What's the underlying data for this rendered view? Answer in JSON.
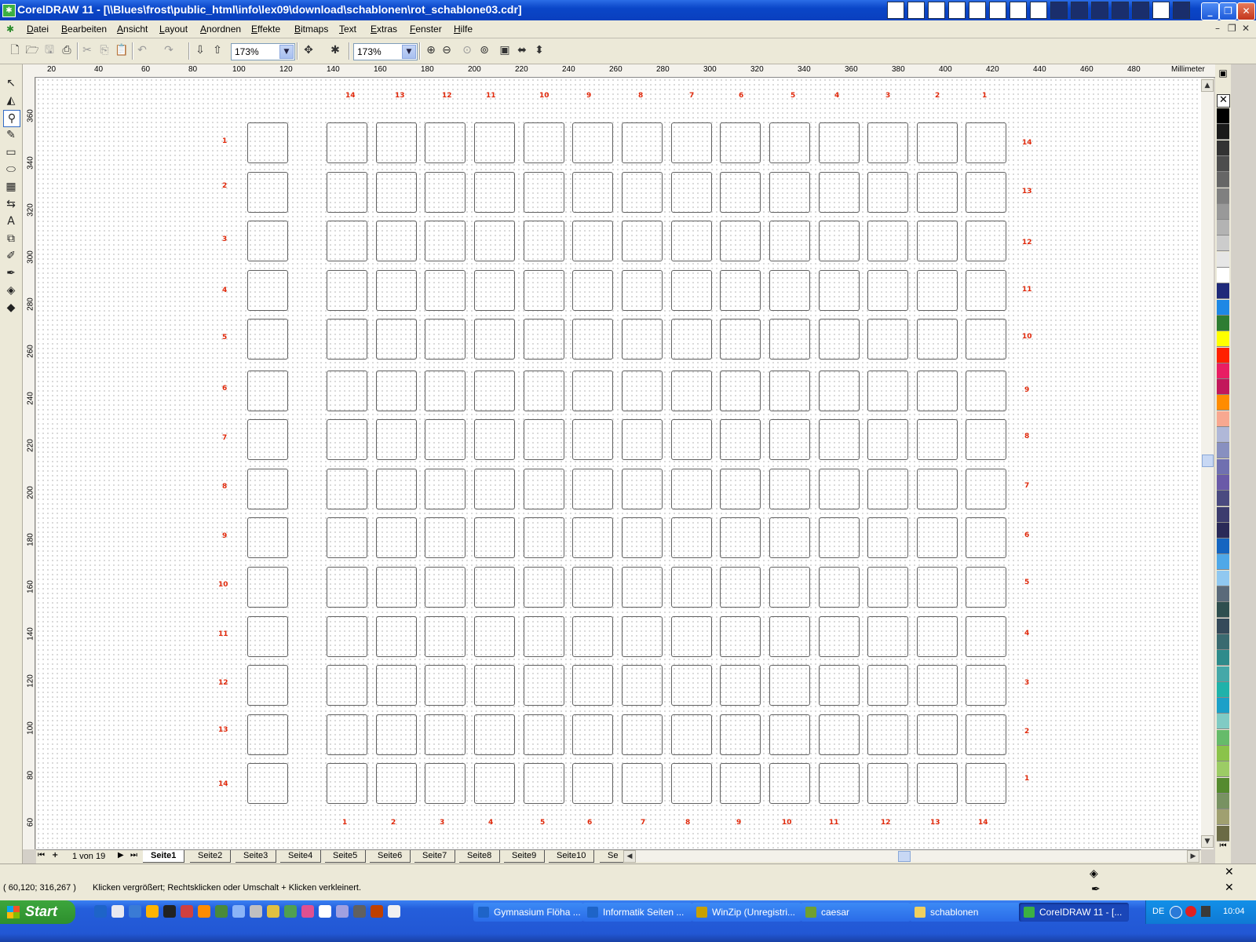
{
  "window": {
    "title": "CorelDRAW 11 - [\\\\Blues\\frost\\public_html\\info\\lex09\\download\\schablonen\\rot_schablone03.cdr]",
    "app_icon": "coreldraw-icon",
    "controls": [
      "minimize",
      "restore",
      "close"
    ]
  },
  "menubar": {
    "items": [
      "Datei",
      "Bearbeiten",
      "Ansicht",
      "Layout",
      "Anordnen",
      "Effekte",
      "Bitmaps",
      "Text",
      "Extras",
      "Fenster",
      "Hilfe"
    ]
  },
  "toolbar": {
    "zoom1": "173%",
    "zoom2": "173%"
  },
  "ruler": {
    "unit": "Millimeter",
    "h_labels": [
      "20",
      "40",
      "60",
      "80",
      "100",
      "120",
      "140",
      "160",
      "180",
      "200",
      "220",
      "240",
      "260",
      "280",
      "300",
      "320",
      "340",
      "360",
      "380",
      "400",
      "420",
      "440",
      "460",
      "480"
    ],
    "v_labels": [
      "360",
      "340",
      "320",
      "300",
      "280",
      "260",
      "240",
      "220",
      "200",
      "180",
      "160",
      "140",
      "120",
      "100",
      "80",
      "60"
    ]
  },
  "canvas": {
    "top_numbers": [
      "14",
      "13",
      "12",
      "11",
      "10",
      "9",
      "8",
      "7",
      "6",
      "5",
      "4",
      "3",
      "2",
      "1"
    ],
    "bottom_numbers": [
      "1",
      "2",
      "3",
      "4",
      "5",
      "6",
      "7",
      "8",
      "9",
      "10",
      "11",
      "12",
      "13",
      "14"
    ],
    "left_numbers": [
      "1",
      "2",
      "3",
      "4",
      "5",
      "6",
      "7",
      "8",
      "9",
      "10",
      "11",
      "12",
      "13",
      "14"
    ],
    "right_numbers": [
      "14",
      "13",
      "12",
      "11",
      "10",
      "9",
      "8",
      "7",
      "6",
      "5",
      "4",
      "3",
      "2",
      "1"
    ],
    "grid_rows": 14,
    "grid_cols_main": 14
  },
  "pages": {
    "counter": "1 von 19",
    "tabs": [
      "Seite1",
      "Seite2",
      "Seite3",
      "Seite4",
      "Seite5",
      "Seite6",
      "Seite7",
      "Seite8",
      "Seite9",
      "Seite10",
      "Se"
    ],
    "active": "Seite1"
  },
  "status": {
    "coords": "( 60,120; 316,267 )",
    "hint": "Klicken vergrößert; Rechtsklicken oder Umschalt + Klicken verkleinert."
  },
  "palette_colors": [
    "#000000",
    "#1a1a1a",
    "#333333",
    "#4d4d4d",
    "#666666",
    "#808080",
    "#999999",
    "#b3b3b3",
    "#cccccc",
    "#e6e6e6",
    "#ffffff",
    "#1f2a7a",
    "#1e88e5",
    "#2e7d32",
    "#ffff00",
    "#ff2000",
    "#e91e63",
    "#c2185b",
    "#ff8c00",
    "#f8a890",
    "#b0b8d8",
    "#8890c0",
    "#7070b0",
    "#6a5aa8",
    "#4a4a80",
    "#3c3c6e",
    "#2a2a58",
    "#1565c0",
    "#4fa8e8",
    "#90c8f0",
    "#5a6a7a",
    "#2f4f4f",
    "#354a5a",
    "#3a6a70",
    "#2e8b8b",
    "#45a8a8",
    "#20b2aa",
    "#1ca0c8",
    "#80cbc4",
    "#66bb6a",
    "#8bc34a",
    "#9ccc65",
    "#558b2f",
    "#789262",
    "#a0a070",
    "#6b6b45"
  ],
  "taskbar": {
    "start": "Start",
    "tasks": [
      "Gymnasium Flöha ...",
      "Informatik Seiten ...",
      "WinZip (Unregistri...",
      "caesar",
      "schablonen",
      "CoreIDRAW 11 - [..."
    ],
    "active_task": "CoreIDRAW 11 - [...",
    "lang": "DE",
    "clock": "10:04"
  }
}
